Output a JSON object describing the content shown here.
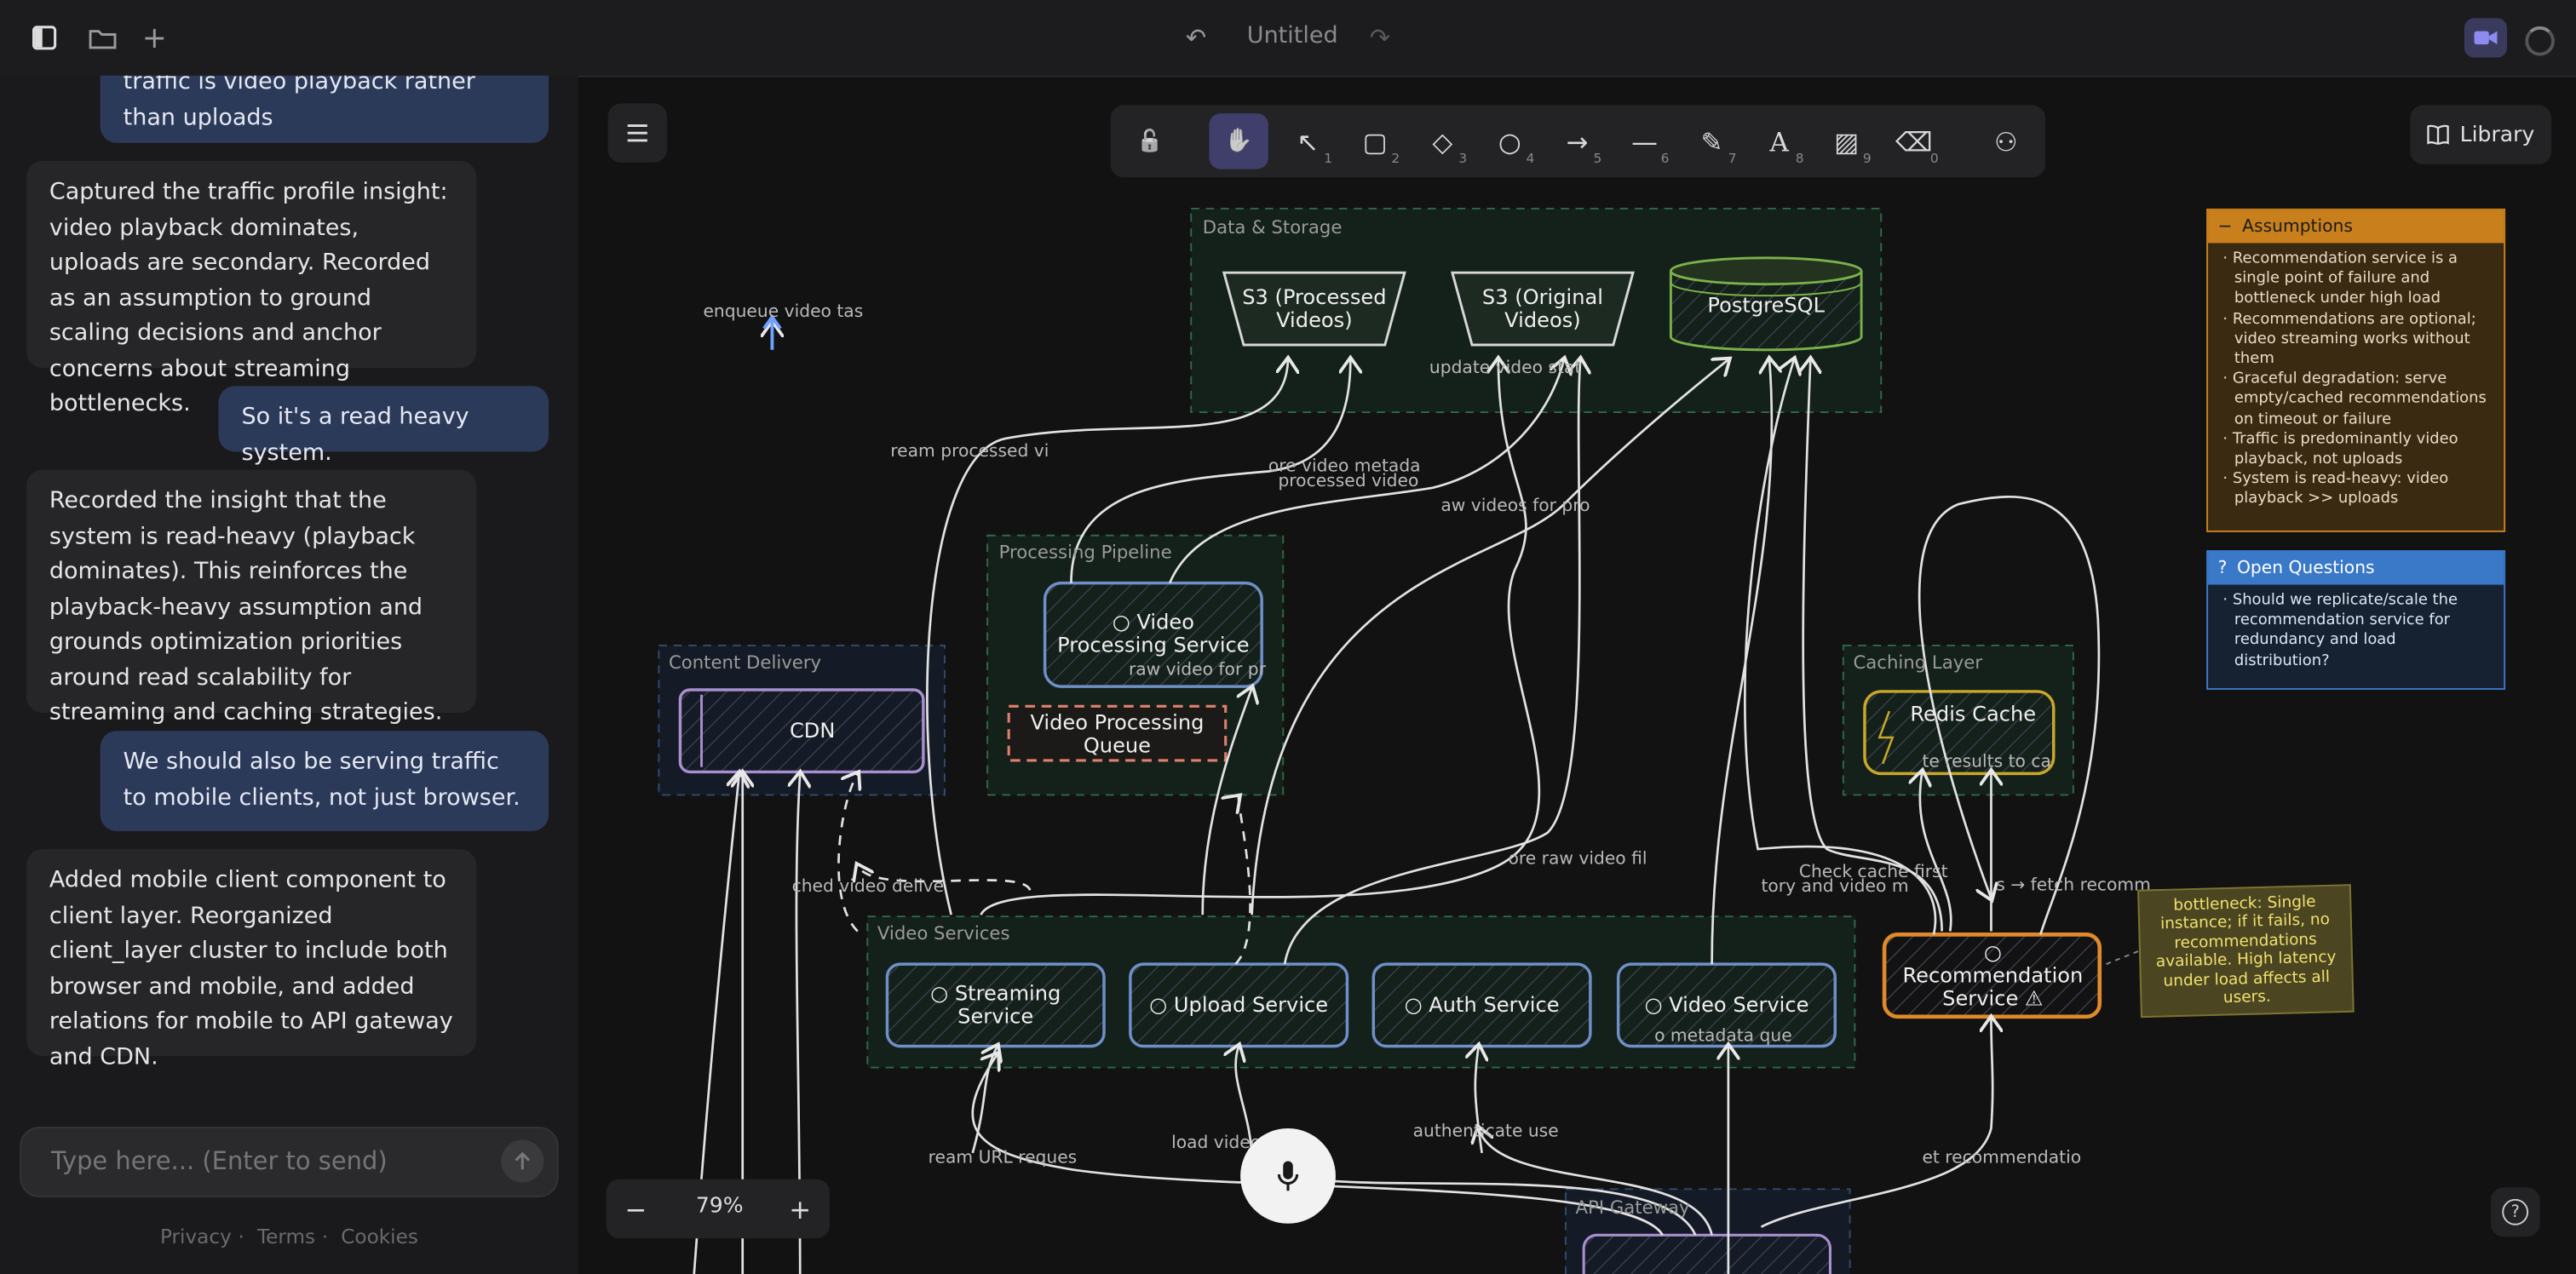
{
  "topbar": {
    "title": "Untitled",
    "icons": {
      "sidebar": "sidebar-icon",
      "folder": "folder-icon",
      "add": "plus-icon",
      "undo": "undo-icon",
      "redo": "redo-icon",
      "video": "video-camera-icon",
      "spinner": "loading-spinner-icon"
    }
  },
  "chat": {
    "messages": [
      {
        "role": "user",
        "text": "traffic is video playback rather than uploads"
      },
      {
        "role": "assistant",
        "text": "Captured the traffic profile insight: video playback dominates, uploads are secondary. Recorded as an assumption to ground scaling decisions and anchor concerns about streaming bottlenecks."
      },
      {
        "role": "user",
        "text": "So it's a read heavy system."
      },
      {
        "role": "assistant",
        "text": "Recorded the insight that the system is read-heavy (playback dominates). This reinforces the playback-heavy assumption and grounds optimization priorities around read scalability for streaming and caching strategies."
      },
      {
        "role": "user",
        "text": "We should also be serving traffic to mobile clients, not just browser."
      },
      {
        "role": "assistant",
        "text": "Added mobile client component to client layer. Reorganized client_layer cluster to include both browser and mobile, and added relations for mobile to API gateway and CDN."
      }
    ],
    "composer_placeholder": "Type here... (Enter to send)",
    "footer": [
      "Privacy",
      "Terms",
      "Cookies"
    ]
  },
  "canvas": {
    "toolbar": [
      {
        "name": "lock",
        "glyph": "🔓",
        "key": ""
      },
      {
        "name": "hand",
        "glyph": "✋",
        "key": "",
        "active": true
      },
      {
        "name": "select",
        "glyph": "↖",
        "key": "1"
      },
      {
        "name": "rectangle",
        "glyph": "▢",
        "key": "2"
      },
      {
        "name": "diamond",
        "glyph": "◇",
        "key": "3"
      },
      {
        "name": "ellipse",
        "glyph": "○",
        "key": "4"
      },
      {
        "name": "arrow",
        "glyph": "→",
        "key": "5"
      },
      {
        "name": "line",
        "glyph": "—",
        "key": "6"
      },
      {
        "name": "draw",
        "glyph": "✎",
        "key": "7"
      },
      {
        "name": "text",
        "glyph": "A",
        "key": "8"
      },
      {
        "name": "image",
        "glyph": "▨",
        "key": "9"
      },
      {
        "name": "eraser",
        "glyph": "⌫",
        "key": "0"
      },
      {
        "name": "more-shapes",
        "glyph": "⚇",
        "key": ""
      }
    ],
    "library_label": "Library",
    "zoom": "79%",
    "help": "?"
  },
  "diagram": {
    "clusters": {
      "data_storage": "Data & Storage",
      "processing": "Processing Pipeline",
      "content_delivery": "Content Delivery",
      "caching": "Caching Layer",
      "video_services": "Video Services",
      "api_gateway": "API Gateway"
    },
    "nodes": {
      "s3_processed": "S3 (Processed Videos)",
      "s3_original": "S3 (Original Videos)",
      "postgres": "PostgreSQL",
      "video_processing": "○ Video Processing Service",
      "processing_queue": "Video Processing Queue",
      "cdn": "CDN",
      "redis": "Redis Cache",
      "streaming": "○ Streaming Service",
      "upload": "○ Upload Service",
      "auth": "○ Auth Service",
      "video_service": "○ Video Service",
      "recommendation": "○ Recommendation Service ⚠"
    },
    "edge_labels": {
      "enqueue": "enqueue video tas",
      "stream_processed": "ream processed vi",
      "update_video_status": "update video stat",
      "store_video_metadata": "ore video metada",
      "processed_video": "processed video",
      "raw_videos": "aw videos for pro",
      "raw_video_for_pr": "raw video for pr",
      "cached_video": "ched video delive",
      "store_raw_video": "ore raw video fil",
      "check_cache": "Check cache first",
      "history": "tory and video m",
      "fetch_recom": "s → fetch recomm",
      "cache_results": "te results to ca",
      "metadata_que": "o metadata que",
      "stream_url": "ream URL reques",
      "load_video": "load video",
      "authenticate": "authenticate use",
      "get_recommendations": "et recommendatio"
    },
    "bottleneck_note": "bottleneck: Single instance; if it fails, no recommendations available. High latency under load affects all users."
  },
  "assumptions": {
    "title": "Assumptions",
    "items": [
      "Recommendation service is a single point of failure and bottleneck under high load",
      "Recommendations are optional; video streaming works without them",
      "Graceful degradation: serve empty/cached recommendations on timeout or failure",
      "Traffic is predominantly video playback, not uploads",
      "System is read-heavy: video playback >> uploads"
    ],
    "color": "#c9801c"
  },
  "open_questions": {
    "title": "Open Questions",
    "items": [
      "Should we replicate/scale the recommendation service for redundancy and load distribution?"
    ],
    "color": "#3a78c8"
  },
  "colors": {
    "accent": "#403e6a",
    "user_bubble": "#2c3a5a",
    "assistant_bubble": "#262628",
    "services_border": "#6f8fc9",
    "recommendation_border": "#e08a2a",
    "postgres_border": "#7bb04a",
    "redis_border": "#c9a72a",
    "cdn_border": "#a98fd0",
    "queue_border": "#e0806a"
  }
}
